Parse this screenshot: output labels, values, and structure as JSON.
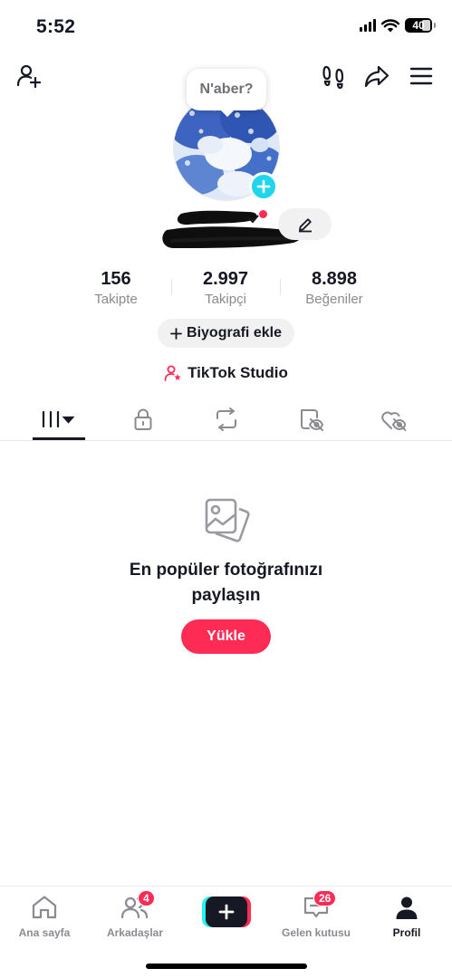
{
  "status_bar": {
    "time": "5:52",
    "battery": "40"
  },
  "profile": {
    "note": "N'aber?",
    "stats": [
      {
        "value": "156",
        "label": "Takipte"
      },
      {
        "value": "2.997",
        "label": "Takipçi"
      },
      {
        "value": "8.898",
        "label": "Beğeniler"
      }
    ],
    "bio_button": "Biyografi ekle",
    "studio_label": "TikTok Studio"
  },
  "tabs": [
    {
      "icon": "grid-icon",
      "active": true
    },
    {
      "icon": "lock-icon"
    },
    {
      "icon": "repost-icon"
    },
    {
      "icon": "hidden-tag-icon"
    },
    {
      "icon": "liked-hidden-icon"
    }
  ],
  "empty_state": {
    "title_line1": "En popüler fotoğrafınızı",
    "title_line2": "paylaşın",
    "button": "Yükle"
  },
  "bottom_nav": {
    "home": "Ana sayfa",
    "friends": "Arkadaşlar",
    "friends_badge": "4",
    "inbox": "Gelen kutusu",
    "inbox_badge": "26",
    "profile": "Profil"
  },
  "colors": {
    "accent": "#fe2c55",
    "cyan": "#20d5ec",
    "text": "#161823",
    "muted": "#8a8b91"
  }
}
